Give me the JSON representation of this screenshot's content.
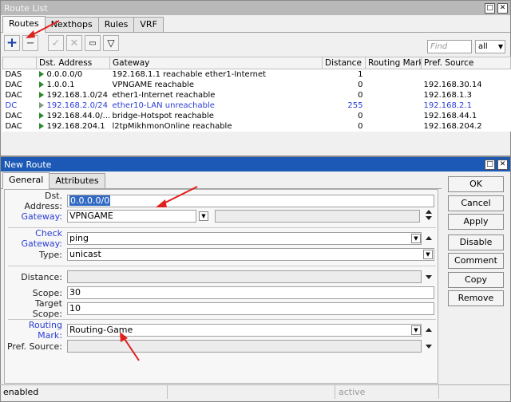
{
  "route_list": {
    "title": "Route List",
    "tabs": [
      "Routes",
      "Nexthops",
      "Rules",
      "VRF"
    ],
    "find_placeholder": "Find",
    "filter_value": "all",
    "columns": [
      "",
      "Dst. Address",
      "Gateway",
      "Distance",
      "Routing Mark",
      "Pref. Source"
    ],
    "rows": [
      {
        "flags": "DAS",
        "dst": "0.0.0.0/0",
        "gateway": "192.168.1.1 reachable ether1-Internet",
        "distance": "1",
        "mark": "",
        "pref_src": ""
      },
      {
        "flags": "DAC",
        "dst": "1.0.0.1",
        "gateway": "VPNGAME reachable",
        "distance": "0",
        "mark": "",
        "pref_src": "192.168.30.14"
      },
      {
        "flags": "DAC",
        "dst": "192.168.1.0/24",
        "gateway": "ether1-Internet reachable",
        "distance": "0",
        "mark": "",
        "pref_src": "192.168.1.3"
      },
      {
        "flags": "DC",
        "dst": "192.168.2.0/24",
        "gateway": "ether10-LAN unreachable",
        "distance": "255",
        "mark": "",
        "pref_src": "192.168.2.1"
      },
      {
        "flags": "DAC",
        "dst": "192.168.44.0/...",
        "gateway": "bridge-Hotspot reachable",
        "distance": "0",
        "mark": "",
        "pref_src": "192.168.44.1"
      },
      {
        "flags": "DAC",
        "dst": "192.168.204.1",
        "gateway": "l2tpMikhmonOnline reachable",
        "distance": "0",
        "mark": "",
        "pref_src": "192.168.204.2"
      }
    ]
  },
  "new_route": {
    "title": "New Route",
    "tabs": [
      "General",
      "Attributes"
    ],
    "fields": {
      "dst_address": {
        "label": "Dst. Address:",
        "value": "0.0.0.0/0"
      },
      "gateway": {
        "label": "Gateway:",
        "value": "VPNGAME"
      },
      "check_gateway": {
        "label": "Check Gateway:",
        "value": "ping"
      },
      "type": {
        "label": "Type:",
        "value": "unicast"
      },
      "distance": {
        "label": "Distance:",
        "value": ""
      },
      "scope": {
        "label": "Scope:",
        "value": "30"
      },
      "target_scope": {
        "label": "Target Scope:",
        "value": "10"
      },
      "routing_mark": {
        "label": "Routing Mark:",
        "value": "Routing-Game"
      },
      "pref_source": {
        "label": "Pref. Source:",
        "value": ""
      }
    },
    "buttons": [
      "OK",
      "Cancel",
      "Apply",
      "Disable",
      "Comment",
      "Copy",
      "Remove"
    ],
    "status": {
      "left": "enabled",
      "right": "active"
    }
  },
  "colors": {
    "title_active": "#1c59b6",
    "link_blue": "#2b3ed6",
    "annotation_red": "#e0201a"
  }
}
